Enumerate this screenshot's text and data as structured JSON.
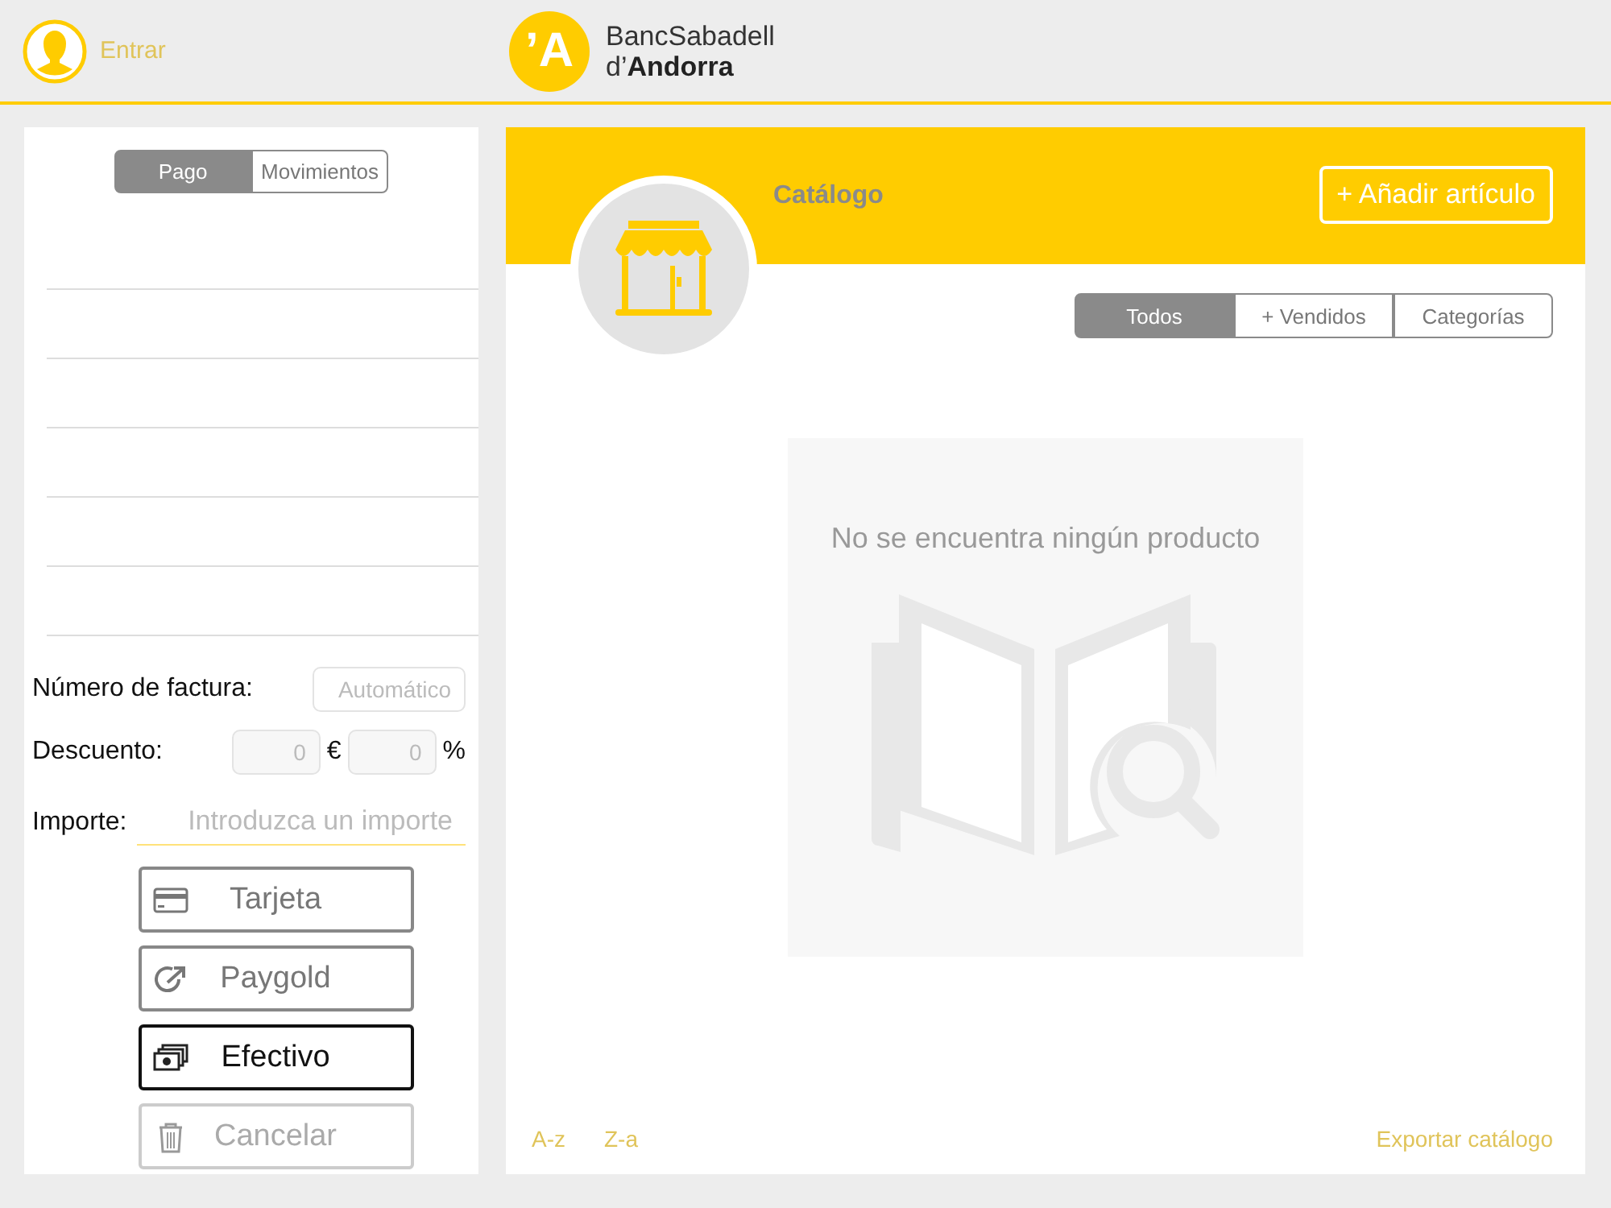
{
  "header": {
    "login_label": "Entrar",
    "logo": {
      "mark": "’A",
      "line1": "BancSabadell",
      "line2": "d’**Andorra**"
    }
  },
  "payment_panel": {
    "tabs": [
      {
        "label": "Pago",
        "selected": true
      },
      {
        "label": "Movimientos",
        "selected": false
      }
    ],
    "invoice": {
      "label": "Número de factura:",
      "placeholder": "Automático"
    },
    "discount": {
      "label": "Descuento:",
      "amount_placeholder": "0",
      "amount_unit": "€",
      "percent_placeholder": "0",
      "percent_unit": "%"
    },
    "amount": {
      "label": "Importe:",
      "placeholder": "Introduzca un importe"
    },
    "buttons": [
      {
        "kind": "card",
        "label": "Tarjeta",
        "selected": false,
        "disabled": false
      },
      {
        "kind": "paygold",
        "label": "Paygold",
        "selected": false,
        "disabled": false
      },
      {
        "kind": "cash",
        "label": "Efectivo",
        "selected": true,
        "disabled": false
      },
      {
        "kind": "trash",
        "label": "Cancelar",
        "selected": false,
        "disabled": true
      }
    ]
  },
  "catalog": {
    "title": "Catálogo",
    "add_button": "+ Añadir artículo",
    "filters": [
      {
        "label": "Todos",
        "selected": true
      },
      {
        "label": "+ Vendidos",
        "selected": false
      },
      {
        "label": "Categorías",
        "selected": false
      }
    ],
    "empty_message": "No se encuentra ningún producto",
    "sort_links": [
      "A-z",
      "Z-a"
    ],
    "export_link": "Exportar catálogo"
  }
}
